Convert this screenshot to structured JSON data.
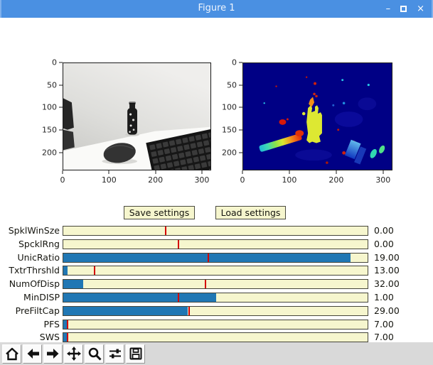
{
  "window": {
    "title": "Figure 1",
    "controls": {
      "minimize": "–",
      "close": "×"
    }
  },
  "plots": {
    "left": {
      "description": "grayscale camera image of desk with bottle, mouse, keyboard",
      "x_ticks": [
        {
          "label": "0",
          "frac": 0.0
        },
        {
          "label": "100",
          "frac": 0.3125
        },
        {
          "label": "200",
          "frac": 0.625
        },
        {
          "label": "300",
          "frac": 0.9375
        }
      ],
      "y_ticks": [
        {
          "label": "0",
          "frac": 0.0
        },
        {
          "label": "50",
          "frac": 0.2083
        },
        {
          "label": "100",
          "frac": 0.4167
        },
        {
          "label": "150",
          "frac": 0.625
        },
        {
          "label": "200",
          "frac": 0.8333
        }
      ]
    },
    "right": {
      "description": "disparity map, jet colormap on dark blue background",
      "x_ticks": [
        {
          "label": "0",
          "frac": 0.0
        },
        {
          "label": "100",
          "frac": 0.3125
        },
        {
          "label": "200",
          "frac": 0.625
        },
        {
          "label": "300",
          "frac": 0.9375
        }
      ],
      "y_ticks": [
        {
          "label": "0",
          "frac": 0.0
        },
        {
          "label": "50",
          "frac": 0.2083
        },
        {
          "label": "100",
          "frac": 0.4167
        },
        {
          "label": "150",
          "frac": 0.625
        },
        {
          "label": "200",
          "frac": 0.8333
        }
      ]
    }
  },
  "buttons": {
    "save": "Save settings",
    "load": "Load settings"
  },
  "sliders": [
    {
      "label": "SpklWinSze",
      "value": "0.00",
      "fill": 0.0,
      "marker": 0.335
    },
    {
      "label": "SpcklRng",
      "value": "0.00",
      "fill": 0.0,
      "marker": 0.377
    },
    {
      "label": "UnicRatio",
      "value": "19.00",
      "fill": 0.944,
      "marker": 0.474
    },
    {
      "label": "TxtrThrshld",
      "value": "13.00",
      "fill": 0.015,
      "marker": 0.1
    },
    {
      "label": "NumOfDisp",
      "value": "32.00",
      "fill": 0.065,
      "marker": 0.465
    },
    {
      "label": "MinDISP",
      "value": "1.00",
      "fill": 0.502,
      "marker": 0.376
    },
    {
      "label": "PreFiltCap",
      "value": "29.00",
      "fill": 0.409,
      "marker": 0.411
    },
    {
      "label": "PFS",
      "value": "7.00",
      "fill": 0.014,
      "marker": 0.012
    },
    {
      "label": "SWS",
      "value": "7.00",
      "fill": 0.014,
      "marker": 0.012
    }
  ],
  "toolbar": {
    "items": [
      "home",
      "back",
      "forward",
      "pan",
      "zoom",
      "configure-subplots",
      "save-figure"
    ]
  },
  "colors": {
    "titlebar": "#4a90e2",
    "slider_track": "#f6f6ce",
    "slider_fill": "#2077b4",
    "slider_init_marker": "#d40000",
    "widget_face": "#f6f6ce",
    "toolbar_bg": "#d9d9d9",
    "disparity_bg": "#000085"
  }
}
